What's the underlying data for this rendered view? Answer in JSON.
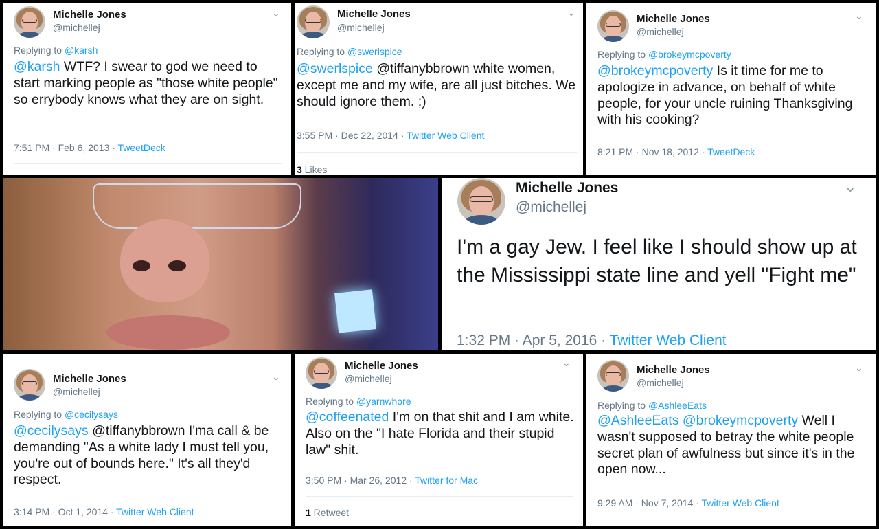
{
  "user": {
    "name": "Michelle Jones",
    "handle": "@michellej"
  },
  "tweets": {
    "t1": {
      "replying_prefix": "Replying to ",
      "replying_to": "@karsh",
      "mention": "@karsh",
      "text": " WTF? I swear to god we need to start marking people as \"those white people\" so errybody knows what they are on sight.",
      "time": "7:51 PM · Feb 6, 2013 · ",
      "client": "TweetDeck"
    },
    "t2": {
      "replying_prefix": "Replying to ",
      "replying_to": "@swerlspice",
      "mention": "@swerlspice",
      "text": " @tiffanybbrown white women, except me and my wife, are all just bitches. We should ignore them. ;)",
      "time": "3:55 PM · Dec 22, 2014 · ",
      "client": "Twitter Web Client",
      "stat_count": "3",
      "stat_label": " Likes"
    },
    "t3": {
      "replying_prefix": "Replying to ",
      "replying_to": "@brokeymcpoverty",
      "mention": "@brokeymcpoverty",
      "text": " Is it time for me to apologize in advance, on behalf of white people, for your uncle ruining Thanksgiving with his cooking?",
      "time": "8:21 PM · Nov 18, 2012 · ",
      "client": "TweetDeck"
    },
    "t4": {
      "text": "I'm a gay Jew. I feel like I should show up at the Mississippi state line and yell \"Fight me\"",
      "time": "1:32 PM · Apr 5, 2016 · ",
      "client": "Twitter Web Client"
    },
    "t5": {
      "replying_prefix": "Replying to ",
      "replying_to": "@cecilysays",
      "mention": "@cecilysays",
      "text": " @tiffanybbrown I'ma call & be demanding \"As a white lady I must tell you, you're out of bounds here.\" It's all they'd respect.",
      "time": "3:14 PM · Oct 1, 2014 · ",
      "client": "Twitter Web Client"
    },
    "t6": {
      "replying_prefix": "Replying to ",
      "replying_to": "@yarnwhore",
      "mention": "@coffeenated",
      "text": " I'm on that shit and I am white. Also on the \"I hate Florida and their stupid law\" shit.",
      "time": "3:50 PM · Mar 26, 2012 · ",
      "client": "Twitter for Mac",
      "stat_count": "1",
      "stat_label": " Retweet"
    },
    "t7": {
      "replying_prefix": "Replying to ",
      "replying_to": "@AshleeEats",
      "mention": "@AshleeEats @brokeymcpoverty",
      "text": " Well I wasn't supposed to betray the white people secret plan of awfulness but since it's in the open now...",
      "time": "9:29 AM · Nov 7, 2014 · ",
      "client": "Twitter Web Client"
    }
  },
  "icons": {
    "chevron": "chevron-down-icon",
    "avatar": "avatar-photo",
    "photo": "selfie-photo"
  },
  "colors": {
    "link": "#1da1f2",
    "muted": "#657786",
    "text": "#14171a"
  }
}
